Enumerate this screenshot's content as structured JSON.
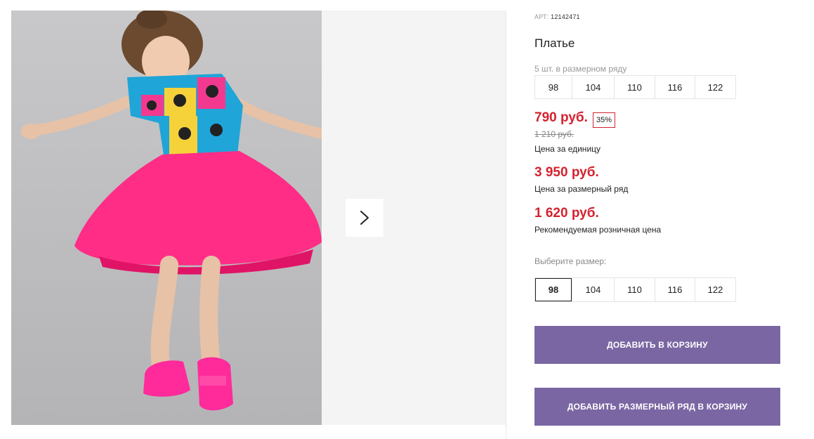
{
  "product": {
    "sku_label": "АРТ:",
    "sku_value": "12142471",
    "title": "Платье",
    "pack_note": "5 шт. в размерном ряду",
    "pack_sizes": [
      "98",
      "104",
      "110",
      "116",
      "122"
    ],
    "price": "790 руб.",
    "discount": "35%",
    "old_price": "1 210 руб.",
    "price_label": "Цена за единицу",
    "pack_price": "3 950 руб.",
    "pack_price_label": "Цена за размерный ряд",
    "rrp_price": "1 620 руб.",
    "rrp_label": "Рекомендуемая розничная цена",
    "choose_size_label": "Выберите размер:",
    "size_options": [
      "98",
      "104",
      "110",
      "116",
      "122"
    ],
    "selected_size": "98"
  },
  "actions": {
    "add_to_cart": "ДОБАВИТЬ В КОРЗИНУ",
    "add_pack_to_cart": "ДОБАВИТЬ РАЗМЕРНЫЙ РЯД В КОРЗИНУ"
  },
  "colors": {
    "price_red": "#d4222f",
    "button_purple": "#7a66a3"
  },
  "icons": {
    "next": "chevron-right-icon"
  }
}
